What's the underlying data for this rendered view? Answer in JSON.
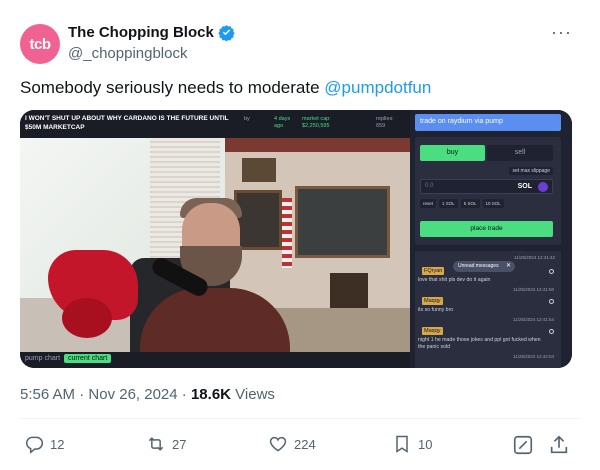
{
  "author": {
    "avatar_text": "tcb",
    "display_name": "The Chopping Block",
    "handle": "@_choppingblock",
    "verified_color": "#1d9bf0"
  },
  "more_label": "···",
  "tweet": {
    "text": "Somebody seriously needs to moderate ",
    "mention": "@pumpdotfun"
  },
  "stream": {
    "banner": "I WON'T SHUT UP ABOUT WHY CARDANO IS THE FUTURE UNTIL $50M MARKETCAP",
    "by_label": "by",
    "age": "4 days ago",
    "market_cap_label": "market cap:",
    "market_cap_value": "$2,250,595",
    "replies_label": "replies:",
    "replies_value": "659",
    "bottom_label": "pump chart",
    "bottom_button": "current chart"
  },
  "trade": {
    "raydium_label": "trade on raydium via pump",
    "buy_label": "buy",
    "sell_label": "sell",
    "slippage_label": "set max slippage",
    "amount_placeholder": "0.0",
    "amount_unit": "SOL",
    "presets": [
      "reset",
      "1 SOL",
      "5 SOL",
      "10 SOL"
    ],
    "place_trade": "place trade"
  },
  "chat": {
    "unread_label": "Unread messages",
    "items": [
      {
        "time_top": "11/25/2024 12:41:42",
        "user": "FQryan",
        "msg": "love that shit pls dev do it again",
        "time": "11/25/2024 12:41:50"
      },
      {
        "user": "Maqqy",
        "msg": "its so funny bro",
        "time": "11/25/2024 12:41:54"
      },
      {
        "user": "Maqqy",
        "msg": "night 1 he made those jokes and ppl got fucked when the panic sold",
        "time": "11/25/2024 12:42:04"
      }
    ]
  },
  "meta": {
    "time": "5:56 AM",
    "date": "Nov 26, 2024",
    "views_count": "18.6K",
    "views_label": "Views"
  },
  "actions": {
    "replies": "12",
    "reposts": "27",
    "likes": "224",
    "bookmarks": "10"
  }
}
